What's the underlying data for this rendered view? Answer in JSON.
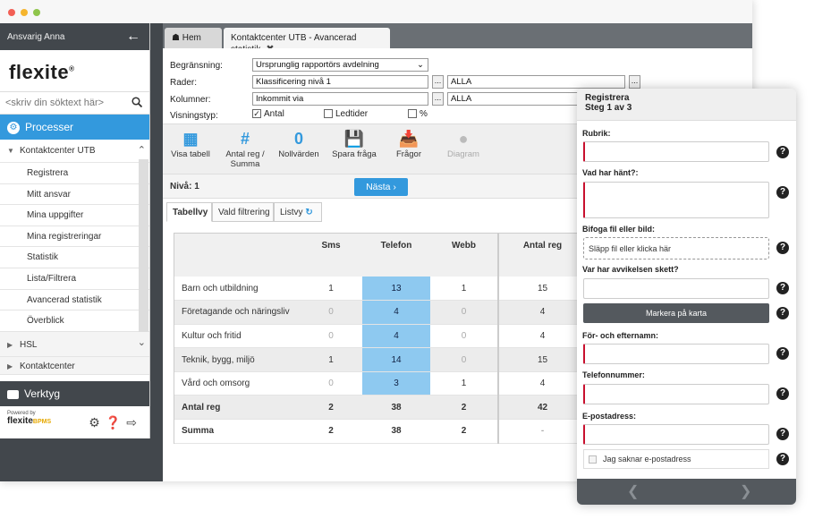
{
  "sidebar": {
    "user": "Ansvarig Anna",
    "logo": "flexite",
    "logo_mark": "®",
    "search_placeholder": "<skriv din söktext här>",
    "processes_label": "Processer",
    "group_open": "Kontaktcenter UTB",
    "items": [
      {
        "label": "Registrera"
      },
      {
        "label": "Mitt ansvar"
      },
      {
        "label": "Mina uppgifter"
      },
      {
        "label": "Mina registreringar"
      },
      {
        "label": "Statistik"
      },
      {
        "label": "Lista/Filtrera"
      },
      {
        "label": "Avancerad statistik"
      },
      {
        "label": "Överblick"
      }
    ],
    "group_hsl": "HSL",
    "group_kontakt": "Kontaktcenter",
    "tools_label": "Verktyg",
    "powered_by": "Powered by",
    "brand": "flexite",
    "brand_suffix": "BPMS"
  },
  "tabs": {
    "home": "Hem",
    "active": "Kontaktcenter UTB - Avancerad statistik"
  },
  "filters": {
    "begransning_label": "Begränsning:",
    "begransning_value": "Ursprunglig rapportörs avdelning",
    "rader_label": "Rader:",
    "rader_value": "Klassificering nivå 1",
    "rader_value2": "ALLA",
    "kolumner_label": "Kolumner:",
    "kolumner_value": "Inkommit via",
    "kolumner_value2": "ALLA",
    "visning_label": "Visningstyp:",
    "opt_antal": "Antal",
    "opt_ledtider": "Ledtider",
    "opt_procent": "%",
    "dots": "..."
  },
  "toolbar": {
    "visa_tabell": "Visa tabell",
    "antal_reg": "Antal reg /",
    "antal_reg2": "Summa",
    "nollvarden": "Nollvärden",
    "nollvarden_icon": "0",
    "spara_fraga": "Spara fråga",
    "fragor": "Frågor",
    "diagram": "Diagram"
  },
  "level": {
    "label": "Nivå: 1",
    "next": "Nästa"
  },
  "view_tabs": {
    "tabellvy": "Tabellvy",
    "vald_filtrering": "Vald filtrering",
    "listvy": "Listvy"
  },
  "table": {
    "headers": [
      "",
      "Sms",
      "Telefon",
      "Webb",
      "Antal reg"
    ],
    "rows": [
      {
        "name": "Barn och utbildning",
        "sms": "1",
        "telefon": "13",
        "webb": "1",
        "antal": "15"
      },
      {
        "name": "Företagande och näringsliv",
        "sms": "0",
        "telefon": "4",
        "webb": "0",
        "antal": "4"
      },
      {
        "name": "Kultur och fritid",
        "sms": "0",
        "telefon": "4",
        "webb": "0",
        "antal": "4"
      },
      {
        "name": "Teknik, bygg, miljö",
        "sms": "1",
        "telefon": "14",
        "webb": "0",
        "antal": "15"
      },
      {
        "name": "Vård och omsorg",
        "sms": "0",
        "telefon": "3",
        "webb": "1",
        "antal": "4"
      }
    ],
    "antal_reg_row": {
      "name": "Antal reg",
      "sms": "2",
      "telefon": "38",
      "webb": "2",
      "antal": "42"
    },
    "summa_row": {
      "name": "Summa",
      "sms": "2",
      "telefon": "38",
      "webb": "2",
      "antal": "-"
    }
  },
  "panel": {
    "title": "Registrera",
    "step": "Steg 1 av 3",
    "rubrik": "Rubrik:",
    "vad_har_hant": "Vad har hänt?:",
    "bifoga": "Bifoga fil eller bild:",
    "drop_text": "Släpp fil eller klicka här",
    "var": "Var har avvikelsen skett?",
    "karta": "Markera på karta",
    "namn": "För- och efternamn:",
    "telefon": "Telefonnummer:",
    "epost": "E-postadress:",
    "saknar": "Jag saknar e-postadress",
    "help": "?"
  }
}
